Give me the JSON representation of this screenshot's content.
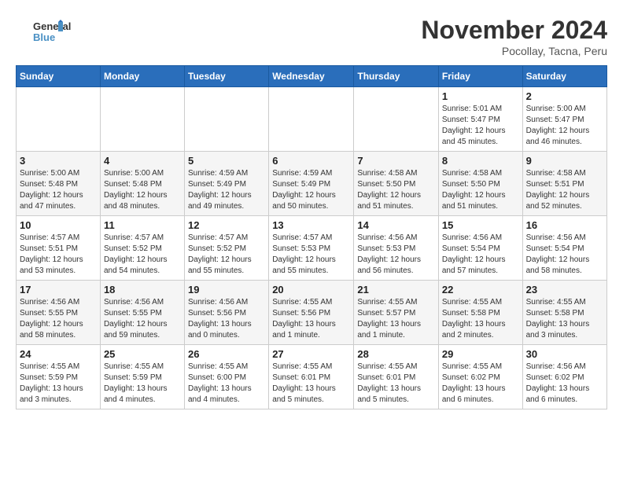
{
  "logo": {
    "line1": "General",
    "line2": "Blue"
  },
  "title": "November 2024",
  "location": "Pocollay, Tacna, Peru",
  "weekdays": [
    "Sunday",
    "Monday",
    "Tuesday",
    "Wednesday",
    "Thursday",
    "Friday",
    "Saturday"
  ],
  "weeks": [
    [
      {
        "day": "",
        "info": ""
      },
      {
        "day": "",
        "info": ""
      },
      {
        "day": "",
        "info": ""
      },
      {
        "day": "",
        "info": ""
      },
      {
        "day": "",
        "info": ""
      },
      {
        "day": "1",
        "info": "Sunrise: 5:01 AM\nSunset: 5:47 PM\nDaylight: 12 hours and 45 minutes."
      },
      {
        "day": "2",
        "info": "Sunrise: 5:00 AM\nSunset: 5:47 PM\nDaylight: 12 hours and 46 minutes."
      }
    ],
    [
      {
        "day": "3",
        "info": "Sunrise: 5:00 AM\nSunset: 5:48 PM\nDaylight: 12 hours and 47 minutes."
      },
      {
        "day": "4",
        "info": "Sunrise: 5:00 AM\nSunset: 5:48 PM\nDaylight: 12 hours and 48 minutes."
      },
      {
        "day": "5",
        "info": "Sunrise: 4:59 AM\nSunset: 5:49 PM\nDaylight: 12 hours and 49 minutes."
      },
      {
        "day": "6",
        "info": "Sunrise: 4:59 AM\nSunset: 5:49 PM\nDaylight: 12 hours and 50 minutes."
      },
      {
        "day": "7",
        "info": "Sunrise: 4:58 AM\nSunset: 5:50 PM\nDaylight: 12 hours and 51 minutes."
      },
      {
        "day": "8",
        "info": "Sunrise: 4:58 AM\nSunset: 5:50 PM\nDaylight: 12 hours and 51 minutes."
      },
      {
        "day": "9",
        "info": "Sunrise: 4:58 AM\nSunset: 5:51 PM\nDaylight: 12 hours and 52 minutes."
      }
    ],
    [
      {
        "day": "10",
        "info": "Sunrise: 4:57 AM\nSunset: 5:51 PM\nDaylight: 12 hours and 53 minutes."
      },
      {
        "day": "11",
        "info": "Sunrise: 4:57 AM\nSunset: 5:52 PM\nDaylight: 12 hours and 54 minutes."
      },
      {
        "day": "12",
        "info": "Sunrise: 4:57 AM\nSunset: 5:52 PM\nDaylight: 12 hours and 55 minutes."
      },
      {
        "day": "13",
        "info": "Sunrise: 4:57 AM\nSunset: 5:53 PM\nDaylight: 12 hours and 55 minutes."
      },
      {
        "day": "14",
        "info": "Sunrise: 4:56 AM\nSunset: 5:53 PM\nDaylight: 12 hours and 56 minutes."
      },
      {
        "day": "15",
        "info": "Sunrise: 4:56 AM\nSunset: 5:54 PM\nDaylight: 12 hours and 57 minutes."
      },
      {
        "day": "16",
        "info": "Sunrise: 4:56 AM\nSunset: 5:54 PM\nDaylight: 12 hours and 58 minutes."
      }
    ],
    [
      {
        "day": "17",
        "info": "Sunrise: 4:56 AM\nSunset: 5:55 PM\nDaylight: 12 hours and 58 minutes."
      },
      {
        "day": "18",
        "info": "Sunrise: 4:56 AM\nSunset: 5:55 PM\nDaylight: 12 hours and 59 minutes."
      },
      {
        "day": "19",
        "info": "Sunrise: 4:56 AM\nSunset: 5:56 PM\nDaylight: 13 hours and 0 minutes."
      },
      {
        "day": "20",
        "info": "Sunrise: 4:55 AM\nSunset: 5:56 PM\nDaylight: 13 hours and 1 minute."
      },
      {
        "day": "21",
        "info": "Sunrise: 4:55 AM\nSunset: 5:57 PM\nDaylight: 13 hours and 1 minute."
      },
      {
        "day": "22",
        "info": "Sunrise: 4:55 AM\nSunset: 5:58 PM\nDaylight: 13 hours and 2 minutes."
      },
      {
        "day": "23",
        "info": "Sunrise: 4:55 AM\nSunset: 5:58 PM\nDaylight: 13 hours and 3 minutes."
      }
    ],
    [
      {
        "day": "24",
        "info": "Sunrise: 4:55 AM\nSunset: 5:59 PM\nDaylight: 13 hours and 3 minutes."
      },
      {
        "day": "25",
        "info": "Sunrise: 4:55 AM\nSunset: 5:59 PM\nDaylight: 13 hours and 4 minutes."
      },
      {
        "day": "26",
        "info": "Sunrise: 4:55 AM\nSunset: 6:00 PM\nDaylight: 13 hours and 4 minutes."
      },
      {
        "day": "27",
        "info": "Sunrise: 4:55 AM\nSunset: 6:01 PM\nDaylight: 13 hours and 5 minutes."
      },
      {
        "day": "28",
        "info": "Sunrise: 4:55 AM\nSunset: 6:01 PM\nDaylight: 13 hours and 5 minutes."
      },
      {
        "day": "29",
        "info": "Sunrise: 4:55 AM\nSunset: 6:02 PM\nDaylight: 13 hours and 6 minutes."
      },
      {
        "day": "30",
        "info": "Sunrise: 4:56 AM\nSunset: 6:02 PM\nDaylight: 13 hours and 6 minutes."
      }
    ]
  ]
}
